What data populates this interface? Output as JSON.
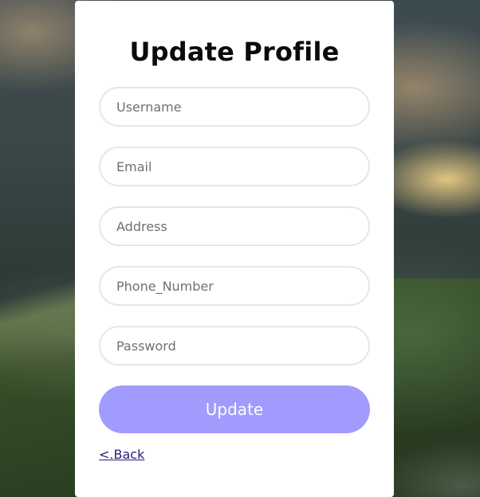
{
  "form": {
    "title": "Update Profile",
    "fields": [
      {
        "placeholder": "Username",
        "value": ""
      },
      {
        "placeholder": "Email",
        "value": ""
      },
      {
        "placeholder": "Address",
        "value": ""
      },
      {
        "placeholder": "Phone_Number",
        "value": ""
      },
      {
        "placeholder": "Password",
        "value": ""
      }
    ],
    "submit_label": "Update",
    "back_link_label": "<.Back"
  },
  "colors": {
    "card_bg": "#ffffff",
    "primary_button": "#a29bfe",
    "link": "#2b1b7a",
    "title": "#0b0b0b",
    "input_border": "#e6e6e6"
  }
}
